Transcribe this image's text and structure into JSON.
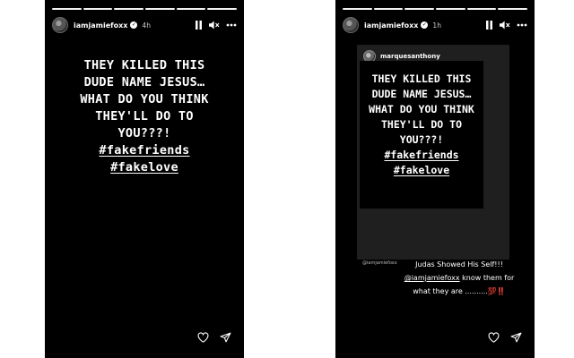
{
  "left_story": {
    "progress_segments": 6,
    "progress_done": 6,
    "username": "iamjamiefoxx",
    "time": "4h",
    "lines": [
      "THEY KILLED THIS",
      "DUDE NAME JESUS…",
      "WHAT DO YOU THINK",
      "THEY'LL DO TO",
      "YOU???!"
    ],
    "hashtags": [
      "#fakefriends",
      "#fakelove"
    ]
  },
  "right_story": {
    "progress_segments": 6,
    "progress_done": 6,
    "username": "iamjamiefoxx",
    "time": "1h",
    "repost_username": "marquesanthony",
    "inner_lines": [
      "THEY KILLED THIS",
      "DUDE NAME JESUS…",
      "WHAT DO YOU THINK",
      "THEY'LL DO TO",
      "YOU???!"
    ],
    "inner_hashtags": [
      "#fakefriends",
      "#fakelove"
    ],
    "inner_credit": "@iamjamiefoxx",
    "caption_line1": "Judas Showed His Self!!!",
    "caption_mention": "@iamjamiefoxx",
    "caption_line2_rest": " know them for",
    "caption_line3": "what they are ..........",
    "caption_emoji": "💯",
    "caption_bang": "‼️"
  },
  "icons": {
    "pause": "pause-icon",
    "mute": "speaker-muted-icon",
    "more": "more-icon",
    "like": "heart-icon",
    "share": "send-icon",
    "verified": "verified-badge-icon"
  },
  "colors": {
    "story_bg": "#000000",
    "repost_card_bg": "#1f1f1f",
    "accent_red": "#d21b1b"
  }
}
